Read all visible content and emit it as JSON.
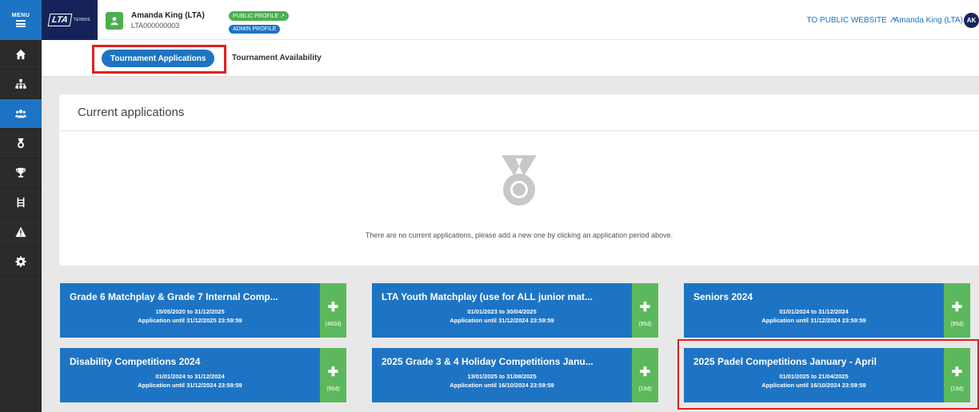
{
  "sidebar": {
    "menu_label": "MENU",
    "items": [
      {
        "icon": "home-icon"
      },
      {
        "icon": "sitemap-icon"
      },
      {
        "icon": "users-icon",
        "active": true
      },
      {
        "icon": "medal-icon"
      },
      {
        "icon": "trophy-icon"
      },
      {
        "icon": "ladder-icon"
      },
      {
        "icon": "warning-icon"
      },
      {
        "icon": "gear-icon"
      }
    ]
  },
  "header": {
    "logo_text": "LTA",
    "logo_sub": "TENNIS",
    "user_name": "Amanda King (LTA)",
    "user_id": "LTA000000003",
    "public_profile_label": "PUBLIC PROFILE",
    "admin_profile_label": "ADMIN PROFILE",
    "public_website_label": "TO PUBLIC WEBSITE",
    "account_name": "Amanda King (LTA)",
    "initials": "AK"
  },
  "tabs": {
    "active": "Tournament Applications",
    "other": "Tournament Availability"
  },
  "current_applications": {
    "title": "Current applications",
    "empty_message": "There are no current applications, please add a new one by clicking an application period above."
  },
  "periods": [
    {
      "title": "Grade 6 Matchplay & Grade 7 Internal Comp...",
      "dates": "15/05/2020 to 31/12/2025",
      "until": "Application until 31/12/2025 23:59:59",
      "days": "(460d)"
    },
    {
      "title": "LTA Youth Matchplay (use for ALL junior mat...",
      "dates": "01/01/2023 to 30/04/2025",
      "until": "Application until 31/12/2024 23:59:59",
      "days": "(95d)"
    },
    {
      "title": "Seniors 2024",
      "dates": "01/01/2024 to 31/12/2024",
      "until": "Application until 31/12/2024 23:59:59",
      "days": "(95d)"
    },
    {
      "title": "Disability Competitions 2024",
      "dates": "01/01/2024 to 31/12/2024",
      "until": "Application until 31/12/2024 23:59:59",
      "days": "(95d)"
    },
    {
      "title": "2025 Grade 3 & 4 Holiday Competitions Janu...",
      "dates": "13/01/2025 to 31/08/2025",
      "until": "Application until 16/10/2024 23:59:59",
      "days": "(19d)"
    },
    {
      "title": "2025 Padel Competitions January - April",
      "dates": "01/01/2025 to 21/04/2025",
      "until": "Application until 16/10/2024 23:59:59",
      "days": "(19d)"
    }
  ],
  "colors": {
    "primary": "#1e74c4",
    "success": "#5cb85c",
    "navy": "#14245a",
    "highlight": "#e02020"
  }
}
